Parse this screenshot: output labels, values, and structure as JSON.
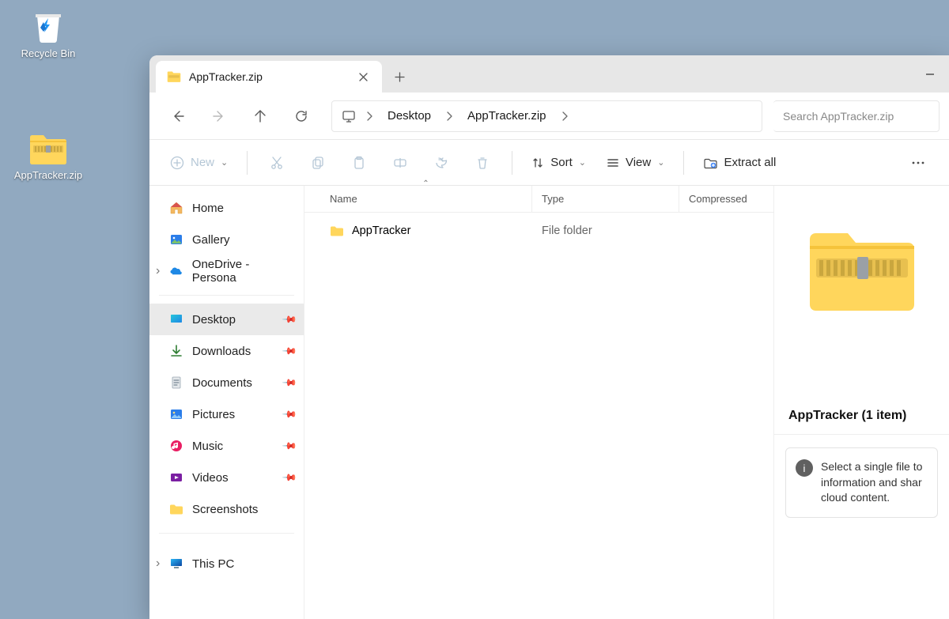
{
  "desktop": {
    "recycle_bin_label": "Recycle Bin",
    "zip_file_label": "AppTracker.zip"
  },
  "tab": {
    "title": "AppTracker.zip"
  },
  "breadcrumb": {
    "items": [
      "Desktop",
      "AppTracker.zip"
    ]
  },
  "search": {
    "placeholder": "Search AppTracker.zip"
  },
  "toolbar": {
    "new_label": "New",
    "sort_label": "Sort",
    "view_label": "View",
    "extract_label": "Extract all"
  },
  "sidebar": {
    "home": "Home",
    "gallery": "Gallery",
    "onedrive": "OneDrive - Persona",
    "desktop": "Desktop",
    "downloads": "Downloads",
    "documents": "Documents",
    "pictures": "Pictures",
    "music": "Music",
    "videos": "Videos",
    "screenshots": "Screenshots",
    "this_pc": "This PC"
  },
  "columns": {
    "name": "Name",
    "type": "Type",
    "compressed": "Compressed"
  },
  "rows": [
    {
      "name": "AppTracker",
      "type": "File folder"
    }
  ],
  "details": {
    "title": "AppTracker (1 item)",
    "message": "Select a single file to information and shar cloud content."
  }
}
